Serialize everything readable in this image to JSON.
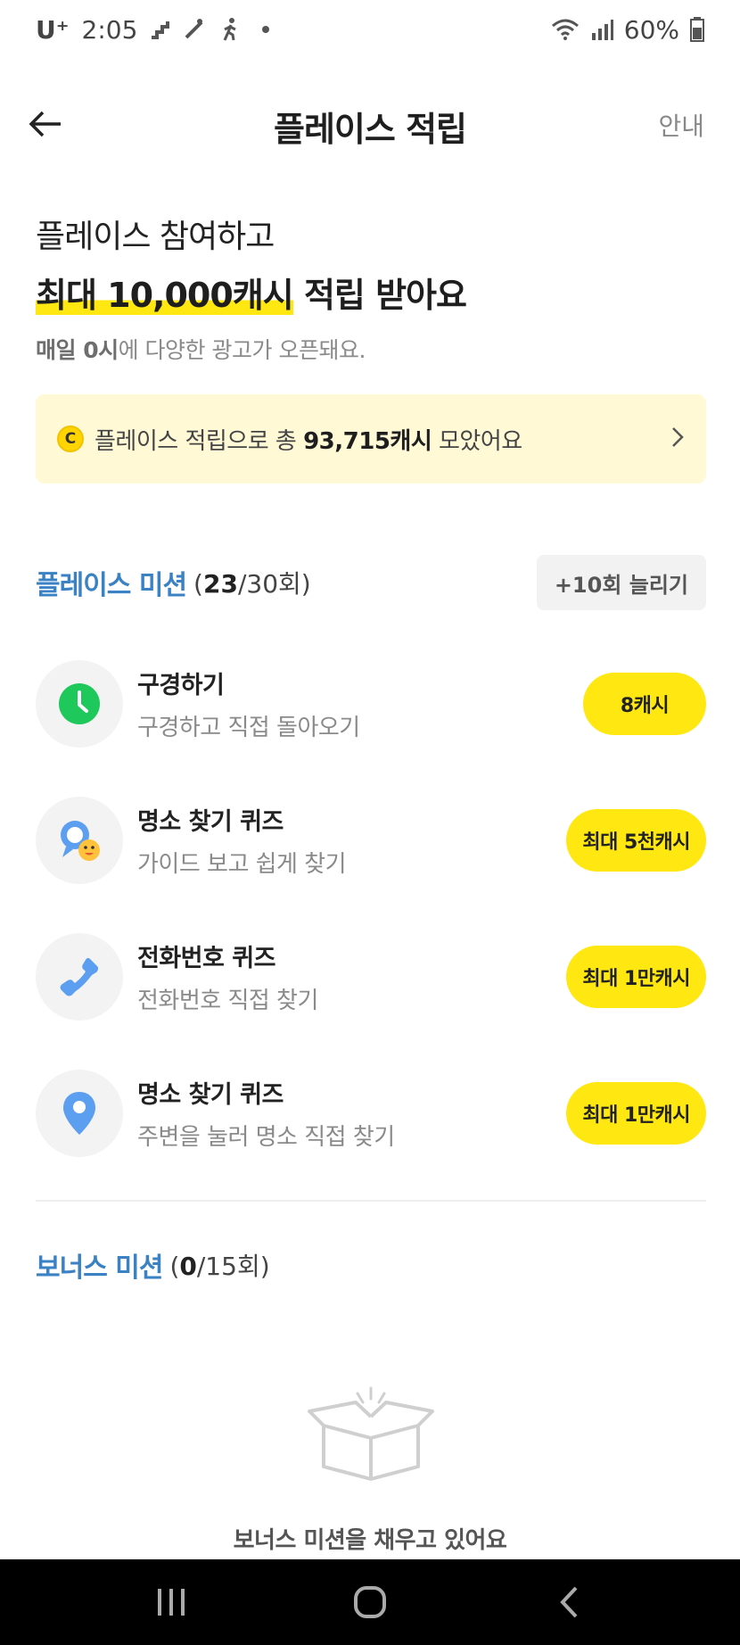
{
  "status_bar": {
    "carrier": "U⁺",
    "time": "2:05",
    "battery": "60%"
  },
  "header": {
    "title": "플레이스 적립",
    "guide_label": "안내"
  },
  "hero": {
    "line1": "플레이스 참여하고",
    "line2_highlight": "최대 10,000캐시",
    "line2_rest": " 적립 받아요",
    "sub_bold": "매일 0시",
    "sub_rest": "에 다양한 광고가 오픈돼요."
  },
  "total_card": {
    "coin_letter": "C",
    "prefix": "플레이스 적립으로 총 ",
    "amount": "93,715캐시",
    "suffix": " 모았어요"
  },
  "place_section": {
    "title": "플레이스 미션",
    "count_open": " (",
    "count_done": "23",
    "count_rest": "/30회)",
    "extend_label": "+10회 늘리기"
  },
  "missions": [
    {
      "icon": "clock-icon",
      "title": "구경하기",
      "subtitle": "구경하고 직접 돌아오기",
      "reward": "8캐시"
    },
    {
      "icon": "search-pin-icon",
      "title": "명소 찾기 퀴즈",
      "subtitle": "가이드 보고 쉽게 찾기",
      "reward": "최대 5천캐시"
    },
    {
      "icon": "phone-icon",
      "title": "전화번호 퀴즈",
      "subtitle": "전화번호 직접 찾기",
      "reward": "최대 1만캐시"
    },
    {
      "icon": "map-pin-icon",
      "title": "명소 찾기 퀴즈",
      "subtitle": "주변을 눌러 명소 직접 찾기",
      "reward": "최대 1만캐시"
    }
  ],
  "bonus_section": {
    "title": "보너스 미션",
    "count_open": " (",
    "count_done": "0",
    "count_rest": "/15회)",
    "empty_text": "보너스 미션을 채우고 있어요"
  },
  "colors": {
    "accent_blue": "#3b82c4",
    "reward_yellow": "#ffe812",
    "card_bg": "#fff9d6",
    "clock_green": "#1ec85a",
    "icon_blue": "#5c9ef0"
  }
}
